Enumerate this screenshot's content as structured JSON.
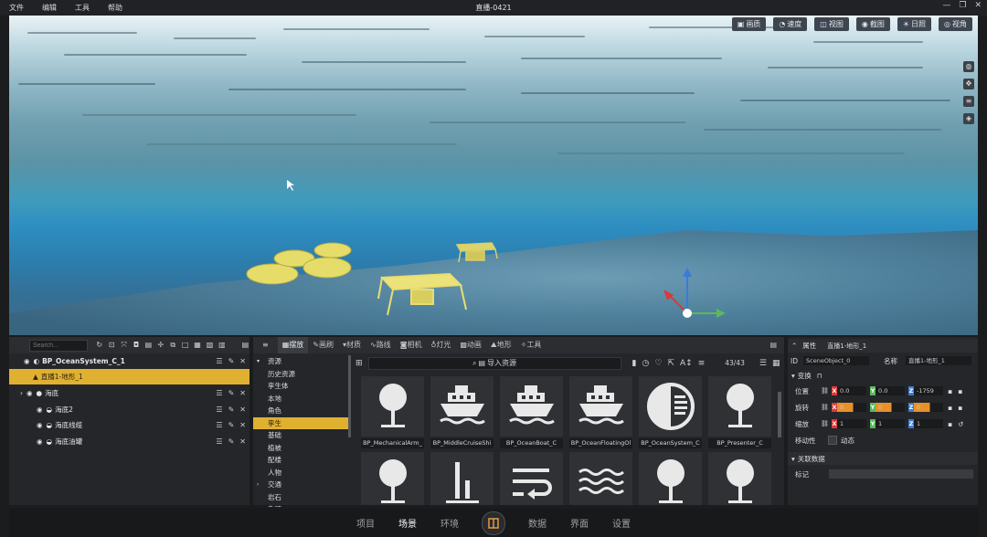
{
  "menu": [
    "文件",
    "编辑",
    "工具",
    "帮助"
  ],
  "window_title": "直播-0421",
  "viewport_toolbar": [
    {
      "icon": "image-quality-icon",
      "label": "画质"
    },
    {
      "icon": "speed-icon",
      "label": "速度"
    },
    {
      "icon": "view-icon",
      "label": "视图"
    },
    {
      "icon": "screenshot-icon",
      "label": "截图"
    },
    {
      "icon": "sun-icon",
      "label": "日照"
    },
    {
      "icon": "eye-icon",
      "label": "视角"
    }
  ],
  "scene": {
    "search_placeholder": "Search...",
    "rows": [
      {
        "label": "BP_OceanSystem_C_1"
      },
      {
        "label": "直播1-地形_1"
      },
      {
        "label": "海底"
      },
      {
        "label": "海底2"
      },
      {
        "label": "海底线缆"
      },
      {
        "label": "海底油罐"
      }
    ]
  },
  "assets": {
    "tabs": [
      "摆放",
      "画刷",
      "材质",
      "路线",
      "相机",
      "灯光",
      "动画",
      "地形",
      "工具"
    ],
    "categories": [
      {
        "label": "资源",
        "arrow": "▾"
      },
      {
        "label": "历史资源",
        "arrow": ""
      },
      {
        "label": "孪生体",
        "arrow": ""
      },
      {
        "label": "本地",
        "arrow": ""
      },
      {
        "label": "角色",
        "arrow": ""
      },
      {
        "label": "孪生",
        "arrow": ""
      },
      {
        "label": "基础",
        "arrow": ""
      },
      {
        "label": "植被",
        "arrow": ""
      },
      {
        "label": "配楼",
        "arrow": ""
      },
      {
        "label": "人物",
        "arrow": ""
      },
      {
        "label": "交通",
        "arrow": "›"
      },
      {
        "label": "岩石",
        "arrow": ""
      },
      {
        "label": "杂项",
        "arrow": ""
      }
    ],
    "import_label": "导入资源",
    "count": "43/43",
    "items": [
      {
        "label": "BP_MechanicalArm_",
        "icon": "pin-icon"
      },
      {
        "label": "BP_MiddleCruiseShi",
        "icon": "ship-icon"
      },
      {
        "label": "BP_OceanBoat_C",
        "icon": "ship-icon"
      },
      {
        "label": "BP_OceanFloatingOl",
        "icon": "ship-icon"
      },
      {
        "label": "BP_OceanSystem_C",
        "icon": "ocean-system-icon"
      },
      {
        "label": "BP_Presenter_C",
        "icon": "pin-icon"
      },
      {
        "label": "",
        "icon": "pin-icon"
      },
      {
        "label": "",
        "icon": "bars-icon"
      },
      {
        "label": "",
        "icon": "wrap-icon"
      },
      {
        "label": "",
        "icon": "waves-icon"
      },
      {
        "label": "",
        "icon": "pin-icon"
      },
      {
        "label": "",
        "icon": "pin-icon"
      }
    ]
  },
  "properties": {
    "header": "属性",
    "object_name": "直播1-地形_1",
    "id_label": "ID",
    "id_value": "SceneObject_0",
    "name_label": "名称",
    "name_value": "直播1-地形_1",
    "transform_label": "变换",
    "position_label": "位置",
    "position": {
      "x": "0.0",
      "y": "0.0",
      "z": "-1759"
    },
    "rotation_label": "旋转",
    "rotation": {
      "x": "0",
      "y": "0",
      "z": "0"
    },
    "scale_label": "缩放",
    "scale": {
      "x": "1",
      "y": "1",
      "z": "1"
    },
    "mobility_label": "移动性",
    "dynamic_label": "动态",
    "related_label": "关联数据",
    "tag_label": "标记",
    "axis_x": "X",
    "axis_y": "Y",
    "axis_z": "Z"
  },
  "bottom_nav": [
    {
      "label": "项目",
      "active": false
    },
    {
      "label": "场景",
      "active": true
    },
    {
      "label": "环境",
      "active": false
    },
    {
      "label": "数据",
      "active": false
    },
    {
      "label": "界面",
      "active": false
    },
    {
      "label": "设置",
      "active": false
    }
  ],
  "colors": {
    "accent": "#e0b030",
    "axis_x": "#d83a3a",
    "axis_y": "#5cb85c",
    "axis_z": "#3a7bd8",
    "bg": "#1b1c1e",
    "panel": "#242629"
  }
}
